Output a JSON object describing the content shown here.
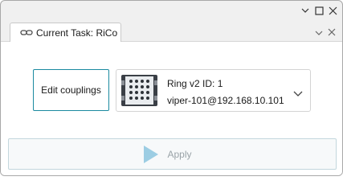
{
  "window": {
    "controls": [
      {
        "name": "chevron-down-icon"
      },
      {
        "name": "maximize-icon"
      },
      {
        "name": "close-icon"
      }
    ]
  },
  "tab": {
    "icon": "link-icon",
    "label": "Current Task: RiCo"
  },
  "panel": {
    "edit_couplings_label": "Edit couplings",
    "device": {
      "icon": "device-board-icon",
      "line1": "Ring v2 ID: 1",
      "line2": "viper-101@192.168.10.101"
    },
    "apply": {
      "icon": "play-icon",
      "label": "Apply",
      "enabled": false
    }
  },
  "colors": {
    "accent_border": "#1b8aa0",
    "apply_icon": "#9ccde3",
    "disabled_text": "#9aa3a8"
  }
}
